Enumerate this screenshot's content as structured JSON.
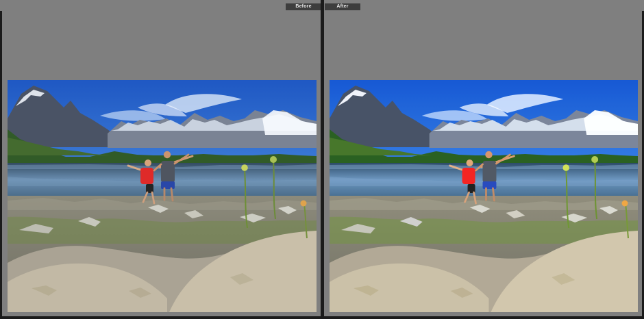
{
  "compare_view": {
    "before_label": "Before",
    "after_label": "After"
  },
  "colors": {
    "panel_bg": "#7f7f7f",
    "window_bg": "#1b1b1b",
    "label_bg": "#3d3d3d",
    "label_text": "#e8e8e8"
  }
}
